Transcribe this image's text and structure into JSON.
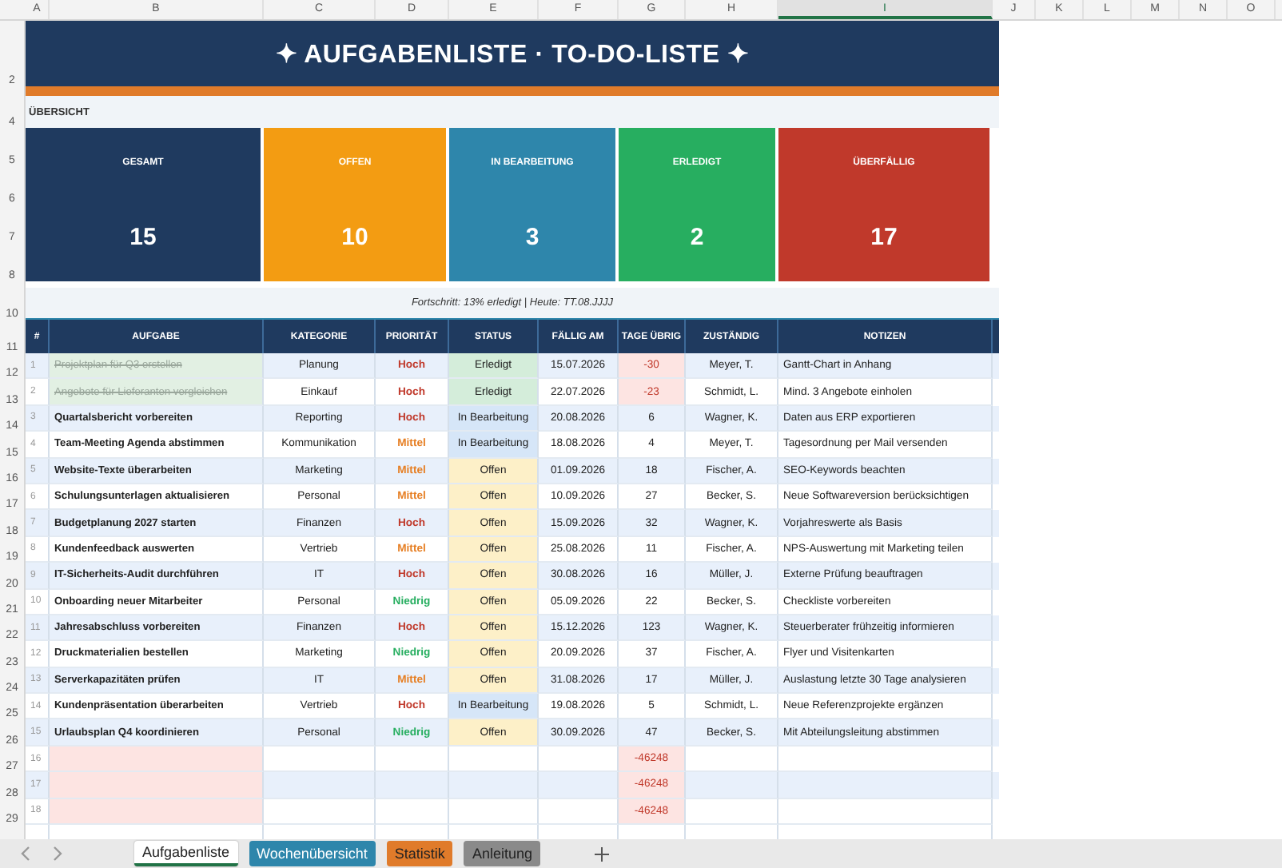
{
  "column_headers": [
    {
      "label": "A",
      "selected": false
    },
    {
      "label": "B",
      "selected": false
    },
    {
      "label": "C",
      "selected": false
    },
    {
      "label": "D",
      "selected": false
    },
    {
      "label": "E",
      "selected": false
    },
    {
      "label": "F",
      "selected": false
    },
    {
      "label": "G",
      "selected": false
    },
    {
      "label": "H",
      "selected": false
    },
    {
      "label": "I",
      "selected": true
    },
    {
      "label": "J",
      "selected": false
    },
    {
      "label": "K",
      "selected": false
    },
    {
      "label": "L",
      "selected": false
    },
    {
      "label": "M",
      "selected": false
    },
    {
      "label": "N",
      "selected": false
    },
    {
      "label": "O",
      "selected": false
    }
  ],
  "title": {
    "row": "2",
    "text": "✦ AUFGABENLISTE · TO-DO-LISTE ✦"
  },
  "overview": {
    "row": "4",
    "label": "ÜBERSICHT"
  },
  "card_rows": [
    "5",
    "6",
    "7",
    "8"
  ],
  "cards": [
    {
      "label": "GESAMT",
      "value": "15",
      "color": "#1f3a5f"
    },
    {
      "label": "OFFEN",
      "value": "10",
      "color": "#f39c12"
    },
    {
      "label": "IN BEARBEITUNG",
      "value": "3",
      "color": "#2e86ab"
    },
    {
      "label": "ERLEDIGT",
      "value": "2",
      "color": "#27ae60"
    },
    {
      "label": "ÜBERFÄLLIG",
      "value": "17",
      "color": "#c0392b"
    }
  ],
  "progress": {
    "row": "10",
    "text": "Fortschritt: 13% erledigt  |  Heute: TT.08.JJJJ"
  },
  "table": {
    "header_row": "11",
    "columns": [
      "#",
      "AUFGABE",
      "KATEGORIE",
      "PRIORITÄT",
      "STATUS",
      "FÄLLIG AM",
      "TAGE ÜBRIG",
      "ZUSTÄNDIG",
      "NOTIZEN"
    ],
    "rows": [
      {
        "row": "12",
        "number": "1",
        "task": "Projektplan für Q3 erstellen",
        "done": true,
        "category": "Planung",
        "priority": {
          "text": "Hoch",
          "color": "#c0392b"
        },
        "status": {
          "text": "Erledigt",
          "color": "#d4edda"
        },
        "due": "15.07.2026",
        "days": "-30",
        "overdue": true,
        "owner": "Meyer, T.",
        "note": "Gantt-Chart in Anhang"
      },
      {
        "row": "13",
        "number": "2",
        "task": "Angebote für Lieferanten vergleichen",
        "done": true,
        "category": "Einkauf",
        "priority": {
          "text": "Hoch",
          "color": "#c0392b"
        },
        "status": {
          "text": "Erledigt",
          "color": "#d4edda"
        },
        "due": "22.07.2026",
        "days": "-23",
        "overdue": true,
        "owner": "Schmidt, L.",
        "note": "Mind. 3 Angebote einholen"
      },
      {
        "row": "14",
        "number": "3",
        "task": "Quartalsbericht vorbereiten",
        "done": false,
        "category": "Reporting",
        "priority": {
          "text": "Hoch",
          "color": "#c0392b"
        },
        "status": {
          "text": "In Bearbeitung",
          "color": "#d6e6f8"
        },
        "due": "20.08.2026",
        "days": "6",
        "overdue": false,
        "owner": "Wagner, K.",
        "note": "Daten aus ERP exportieren"
      },
      {
        "row": "15",
        "number": "4",
        "task": "Team-Meeting Agenda abstimmen",
        "done": false,
        "category": "Kommunikation",
        "priority": {
          "text": "Mittel",
          "color": "#e67e22"
        },
        "status": {
          "text": "In Bearbeitung",
          "color": "#d6e6f8"
        },
        "due": "18.08.2026",
        "days": "4",
        "overdue": false,
        "owner": "Meyer, T.",
        "note": "Tagesordnung per Mail versenden"
      },
      {
        "row": "16",
        "number": "5",
        "task": "Website-Texte überarbeiten",
        "done": false,
        "category": "Marketing",
        "priority": {
          "text": "Mittel",
          "color": "#e67e22"
        },
        "status": {
          "text": "Offen",
          "color": "#fdf0c8"
        },
        "due": "01.09.2026",
        "days": "18",
        "overdue": false,
        "owner": "Fischer, A.",
        "note": "SEO-Keywords beachten"
      },
      {
        "row": "17",
        "number": "6",
        "task": "Schulungsunterlagen aktualisieren",
        "done": false,
        "category": "Personal",
        "priority": {
          "text": "Mittel",
          "color": "#e67e22"
        },
        "status": {
          "text": "Offen",
          "color": "#fdf0c8"
        },
        "due": "10.09.2026",
        "days": "27",
        "overdue": false,
        "owner": "Becker, S.",
        "note": "Neue Softwareversion berücksichtigen"
      },
      {
        "row": "18",
        "number": "7",
        "task": "Budgetplanung 2027 starten",
        "done": false,
        "category": "Finanzen",
        "priority": {
          "text": "Hoch",
          "color": "#c0392b"
        },
        "status": {
          "text": "Offen",
          "color": "#fdf0c8"
        },
        "due": "15.09.2026",
        "days": "32",
        "overdue": false,
        "owner": "Wagner, K.",
        "note": "Vorjahreswerte als Basis"
      },
      {
        "row": "19",
        "number": "8",
        "task": "Kundenfeedback auswerten",
        "done": false,
        "category": "Vertrieb",
        "priority": {
          "text": "Mittel",
          "color": "#e67e22"
        },
        "status": {
          "text": "Offen",
          "color": "#fdf0c8"
        },
        "due": "25.08.2026",
        "days": "11",
        "overdue": false,
        "owner": "Fischer, A.",
        "note": "NPS-Auswertung mit Marketing teilen"
      },
      {
        "row": "20",
        "number": "9",
        "task": "IT-Sicherheits-Audit durchführen",
        "done": false,
        "category": "IT",
        "priority": {
          "text": "Hoch",
          "color": "#c0392b"
        },
        "status": {
          "text": "Offen",
          "color": "#fdf0c8"
        },
        "due": "30.08.2026",
        "days": "16",
        "overdue": false,
        "owner": "Müller, J.",
        "note": "Externe Prüfung beauftragen"
      },
      {
        "row": "21",
        "number": "10",
        "task": "Onboarding neuer Mitarbeiter",
        "done": false,
        "category": "Personal",
        "priority": {
          "text": "Niedrig",
          "color": "#27ae60"
        },
        "status": {
          "text": "Offen",
          "color": "#fdf0c8"
        },
        "due": "05.09.2026",
        "days": "22",
        "overdue": false,
        "owner": "Becker, S.",
        "note": "Checkliste vorbereiten"
      },
      {
        "row": "22",
        "number": "11",
        "task": "Jahresabschluss vorbereiten",
        "done": false,
        "category": "Finanzen",
        "priority": {
          "text": "Hoch",
          "color": "#c0392b"
        },
        "status": {
          "text": "Offen",
          "color": "#fdf0c8"
        },
        "due": "15.12.2026",
        "days": "123",
        "overdue": false,
        "owner": "Wagner, K.",
        "note": "Steuerberater frühzeitig informieren"
      },
      {
        "row": "23",
        "number": "12",
        "task": "Druckmaterialien bestellen",
        "done": false,
        "category": "Marketing",
        "priority": {
          "text": "Niedrig",
          "color": "#27ae60"
        },
        "status": {
          "text": "Offen",
          "color": "#fdf0c8"
        },
        "due": "20.09.2026",
        "days": "37",
        "overdue": false,
        "owner": "Fischer, A.",
        "note": "Flyer und Visitenkarten"
      },
      {
        "row": "24",
        "number": "13",
        "task": "Serverkapazitäten prüfen",
        "done": false,
        "category": "IT",
        "priority": {
          "text": "Mittel",
          "color": "#e67e22"
        },
        "status": {
          "text": "Offen",
          "color": "#fdf0c8"
        },
        "due": "31.08.2026",
        "days": "17",
        "overdue": false,
        "owner": "Müller, J.",
        "note": "Auslastung letzte 30 Tage analysieren"
      },
      {
        "row": "25",
        "number": "14",
        "task": "Kundenpräsentation überarbeiten",
        "done": false,
        "category": "Vertrieb",
        "priority": {
          "text": "Hoch",
          "color": "#c0392b"
        },
        "status": {
          "text": "In Bearbeitung",
          "color": "#d6e6f8"
        },
        "due": "19.08.2026",
        "days": "5",
        "overdue": false,
        "owner": "Schmidt, L.",
        "note": "Neue Referenzprojekte ergänzen"
      },
      {
        "row": "26",
        "number": "15",
        "task": "Urlaubsplan Q4 koordinieren",
        "done": false,
        "category": "Personal",
        "priority": {
          "text": "Niedrig",
          "color": "#27ae60"
        },
        "status": {
          "text": "Offen",
          "color": "#fdf0c8"
        },
        "due": "30.09.2026",
        "days": "47",
        "overdue": false,
        "owner": "Becker, S.",
        "note": "Mit Abteilungsleitung abstimmen"
      },
      {
        "row": "27",
        "number": "16",
        "done": false,
        "days": "-46248",
        "overdue": true
      },
      {
        "row": "28",
        "number": "17",
        "done": false,
        "days": "-46248",
        "overdue": true
      },
      {
        "row": "29",
        "number": "18",
        "done": false,
        "days": "-46248",
        "overdue": true
      }
    ]
  },
  "sheet_tabs": [
    {
      "label": "Aufgabenliste",
      "selected": true,
      "color": "#ffffff"
    },
    {
      "label": "Wochenübersicht",
      "selected": false,
      "color": "#2e86ab"
    },
    {
      "label": "Statistik",
      "selected": false,
      "color": "#e07b2a"
    },
    {
      "label": "Anleitung",
      "selected": false,
      "color": "#8a8a8a"
    }
  ]
}
